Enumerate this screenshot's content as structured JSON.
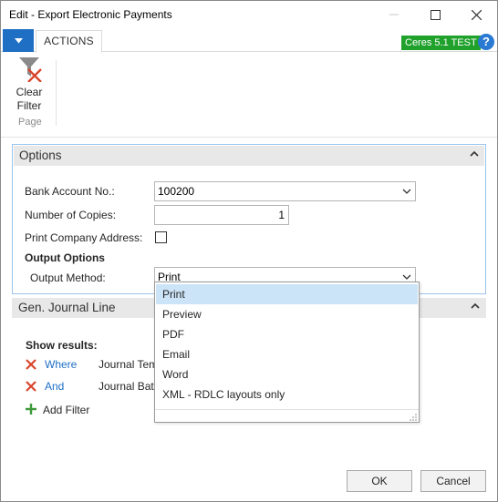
{
  "window": {
    "title": "Edit - Export Electronic Payments"
  },
  "ribbon": {
    "tab_actions": "ACTIONS",
    "env_badge": "Ceres 5.1 TEST",
    "help_label": "?",
    "clear_filter_line1": "Clear",
    "clear_filter_line2": "Filter",
    "group_label": "Page"
  },
  "options": {
    "section_title": "Options",
    "bank_account_label": "Bank Account No.:",
    "bank_account_value": "100200",
    "copies_label": "Number of Copies:",
    "copies_value": "1",
    "print_company_label": "Print Company Address:",
    "print_company_checked": false,
    "output_options_heading": "Output Options",
    "output_method_label": "Output Method:",
    "output_method_value": "Print"
  },
  "output_method_options": [
    "Print",
    "Preview",
    "PDF",
    "Email",
    "Word",
    "XML - RDLC layouts only"
  ],
  "gen_journal": {
    "section_title": "Gen. Journal Line",
    "show_results": "Show results:",
    "filters": [
      {
        "keyword": "Where",
        "field": "Journal Tem"
      },
      {
        "keyword": "And",
        "field": "Journal Bat"
      }
    ],
    "add_filter": "Add Filter"
  },
  "buttons": {
    "ok": "OK",
    "cancel": "Cancel"
  },
  "colors": {
    "accent_blue": "#1f6fc5",
    "badge_green": "#20a12c",
    "remove_red": "#d9452c",
    "add_green": "#3d9a3a",
    "selected_option": "#cce4f7"
  }
}
